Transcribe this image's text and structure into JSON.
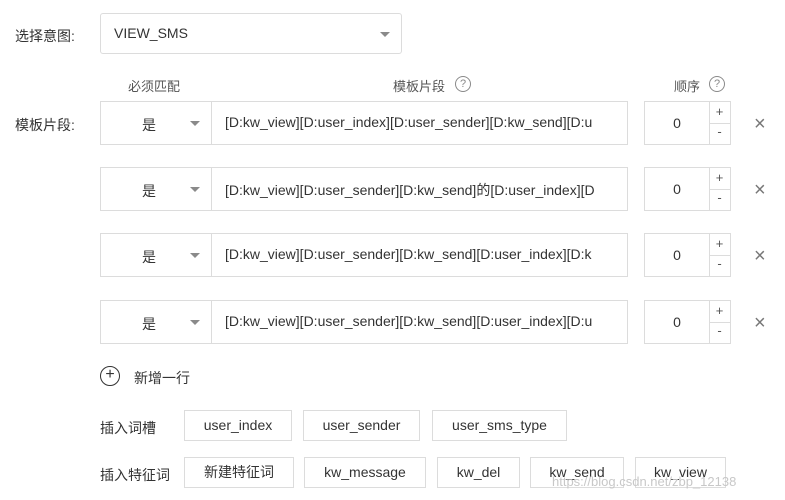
{
  "form": {
    "intent_label": "选择意图:",
    "intent_value": "VIEW_SMS",
    "segments_label": "模板片段:"
  },
  "columns": {
    "required": "必须匹配",
    "template": "模板片段",
    "order": "顺序"
  },
  "rows": [
    {
      "required": "是",
      "template": "[D:kw_view][D:user_index][D:user_sender][D:kw_send][D:u",
      "order": "0"
    },
    {
      "required": "是",
      "template": "[D:kw_view][D:user_sender][D:kw_send]的[D:user_index][D",
      "order": "0"
    },
    {
      "required": "是",
      "template": "[D:kw_view][D:user_sender][D:kw_send][D:user_index][D:k",
      "order": "0"
    },
    {
      "required": "是",
      "template": "[D:kw_view][D:user_sender][D:kw_send][D:user_index][D:u",
      "order": "0"
    }
  ],
  "stepper": {
    "plus": "+",
    "minus": "-"
  },
  "close_symbol": "×",
  "help_symbol": "?",
  "add_row": {
    "icon": "+",
    "label": "新增一行"
  },
  "slots": {
    "label": "插入词槽",
    "items": [
      "user_index",
      "user_sender",
      "user_sms_type"
    ]
  },
  "keywords": {
    "label": "插入特征词",
    "items": [
      "新建特征词",
      "kw_message",
      "kw_del",
      "kw_send",
      "kw_view"
    ]
  },
  "watermark": "https://blog.csdn.net/zbp_12138",
  "icons": {
    "caret": "chevron-down-icon",
    "help": "help-circle-icon",
    "close": "close-icon",
    "add": "plus-circle-icon"
  }
}
